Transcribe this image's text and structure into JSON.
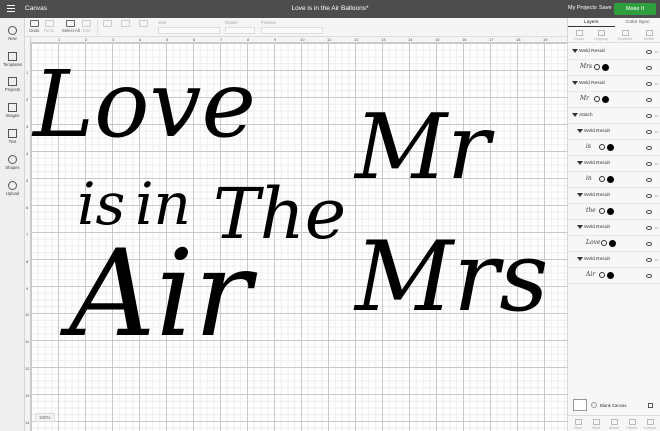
{
  "topbar": {
    "app_name": "Canvas",
    "doc_title": "Love is in the Air Balloons*",
    "my_projects": "My Projects",
    "save": "Save",
    "make_it": "Make It"
  },
  "toolbar": {
    "undo": "Undo",
    "redo": "Redo",
    "select_all": "Select All",
    "edit": "Edit",
    "size": "Size",
    "rotate": "Rotate",
    "position": "Position"
  },
  "leftnav": [
    {
      "label": "New"
    },
    {
      "label": "Templates"
    },
    {
      "label": "Projects"
    },
    {
      "label": "Images"
    },
    {
      "label": "Text"
    },
    {
      "label": "Shapes"
    },
    {
      "label": "Upload"
    }
  ],
  "canvas": {
    "ruler_top": [
      "1",
      "2",
      "3",
      "4",
      "5",
      "6",
      "7",
      "8",
      "9",
      "10",
      "11",
      "12",
      "13",
      "14",
      "15",
      "16",
      "17",
      "18",
      "19"
    ],
    "ruler_left": [
      "1",
      "2",
      "3",
      "4",
      "5",
      "6",
      "7",
      "8",
      "9",
      "10",
      "11",
      "12",
      "13",
      "14"
    ],
    "art": {
      "love": "Love",
      "is": "is",
      "in": "in",
      "the": "The",
      "air": "Air",
      "mr": "Mr",
      "mrs": "Mrs"
    },
    "zoom": "100%"
  },
  "panel": {
    "tabs": [
      "Layers",
      "Color Sync"
    ],
    "tools": [
      "Group",
      "Ungroup",
      "Duplicate",
      "Delete"
    ],
    "layers": [
      {
        "label": "Weld Result",
        "thumb": "Mrs",
        "level": 0
      },
      {
        "label": "Weld Result",
        "thumb": "Mr",
        "level": 0
      },
      {
        "label": "Attach",
        "thumb": "",
        "level": 0
      },
      {
        "label": "Weld Result",
        "thumb": "is",
        "level": 1
      },
      {
        "label": "Weld Result",
        "thumb": "in",
        "level": 1
      },
      {
        "label": "Weld Result",
        "thumb": "the",
        "level": 1
      },
      {
        "label": "Weld Result",
        "thumb": "Love",
        "level": 1
      },
      {
        "label": "Weld Result",
        "thumb": "Air",
        "level": 1
      }
    ],
    "blank_canvas": "Blank Canvas",
    "bottom_tools": [
      "Slice",
      "Weld",
      "Attach",
      "Flatten",
      "Contour"
    ]
  }
}
